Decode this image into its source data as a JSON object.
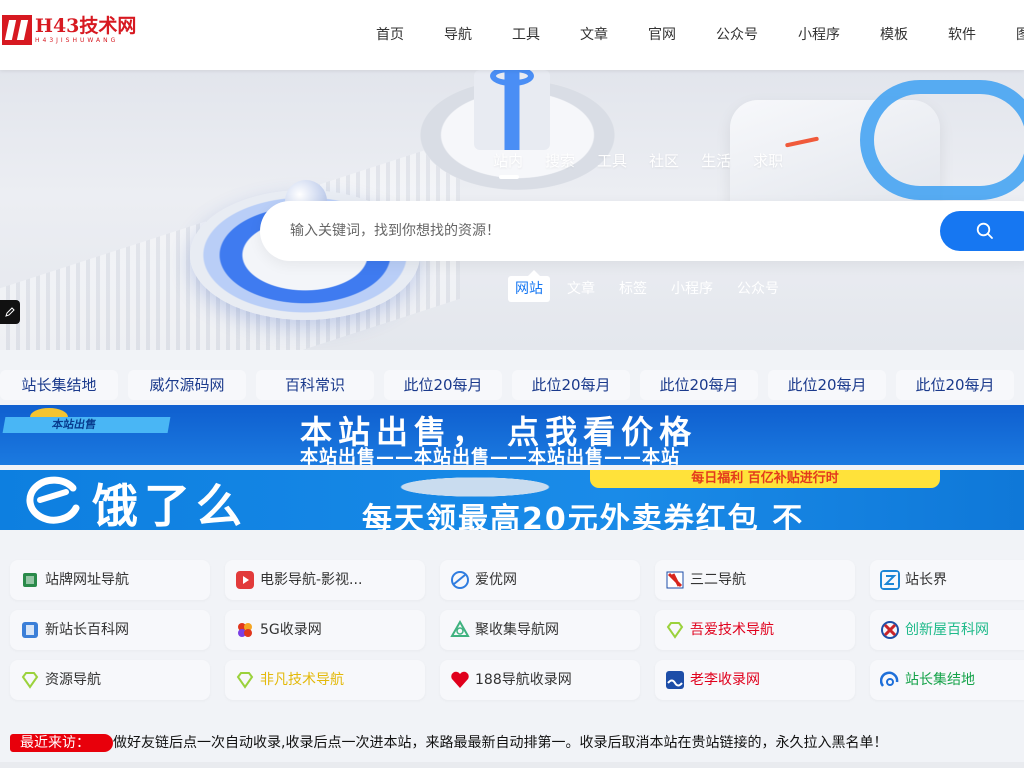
{
  "header": {
    "logo": {
      "title": "H43技术网",
      "subtitle": "H43JISHUWANG"
    },
    "nav": [
      "首页",
      "导航",
      "工具",
      "文章",
      "官网",
      "公众号",
      "小程序",
      "模板",
      "软件",
      "图"
    ]
  },
  "hero": {
    "search_tabs": [
      "站内",
      "搜索",
      "工具",
      "社区",
      "生活",
      "求职"
    ],
    "active_tab": "站内",
    "search": {
      "placeholder": "输入关键词，找到你想找的资源！",
      "value": ""
    },
    "scope_tabs": [
      "网站",
      "文章",
      "标签",
      "小程序",
      "公众号"
    ],
    "active_scope": "网站"
  },
  "friend_links": [
    "站长集结地",
    "威尔源码网",
    "百科常识",
    "此位20每月",
    "此位20每月",
    "此位20每月",
    "此位20每月",
    "此位20每月"
  ],
  "banners": {
    "sale": {
      "tag": "本站出售",
      "headline": "本站出售， 点我看价格",
      "subline": "本站出售——本站出售——本站出售——本站"
    },
    "eleme": {
      "brand": "饿了么",
      "pill": "每日福利  百亿补贴进行时",
      "slogan": "每天领最高20元外卖券红包  不"
    }
  },
  "sites": [
    {
      "name": "站牌网址导航",
      "color": "#333333",
      "icon": "cube-icon",
      "iconColor": "#2a8a4a"
    },
    {
      "name": "电影导航-影视...",
      "color": "#333333",
      "icon": "play-icon",
      "iconColor": "#e23b3b"
    },
    {
      "name": "爱优网",
      "color": "#333333",
      "icon": "globe-icon",
      "iconColor": "#2f7de0"
    },
    {
      "name": "三二导航",
      "color": "#333333",
      "icon": "flag-icon",
      "iconColor": "#d7261e"
    },
    {
      "name": "站长界",
      "color": "#333333",
      "icon": "z-icon",
      "iconColor": "#1c86d6"
    },
    {
      "name": "新站长百科网",
      "color": "#333333",
      "icon": "book-icon",
      "iconColor": "#3b7fd8"
    },
    {
      "name": "5G收录网",
      "color": "#333333",
      "icon": "flower-icon",
      "iconColor": "#e0361c"
    },
    {
      "name": "聚收集导航网",
      "color": "#333333",
      "icon": "triangle-icon",
      "iconColor": "#3fb27f"
    },
    {
      "name": "吾爱技术导航",
      "color": "#e0001c",
      "icon": "diamond-icon",
      "iconColor": "#9bd23c"
    },
    {
      "name": "创新屋百科网",
      "color": "#1fba8a",
      "icon": "x-icon",
      "iconColor": "#c8242a"
    },
    {
      "name": "资源导航",
      "color": "#333333",
      "icon": "diamond-icon",
      "iconColor": "#9bd23c"
    },
    {
      "name": "非凡技术导航",
      "color": "#e3b90a",
      "icon": "diamond-icon",
      "iconColor": "#9bd23c"
    },
    {
      "name": "188导航收录网",
      "color": "#333333",
      "icon": "heart-icon",
      "iconColor": "#e0001c"
    },
    {
      "name": "老李收录网",
      "color": "#e0001c",
      "icon": "waves-icon",
      "iconColor": "#1d4ea8"
    },
    {
      "name": "站长集结地",
      "color": "#16a34a",
      "icon": "swirl-icon",
      "iconColor": "#1e6fd9"
    }
  ],
  "notice": {
    "badge": "最近来访：",
    "text": "做好友链后点一次自动收录,收录后点一次进本站，来路最最新自动排第一。收录后取消本站在贵站链接的，永久拉入黑名单！"
  }
}
